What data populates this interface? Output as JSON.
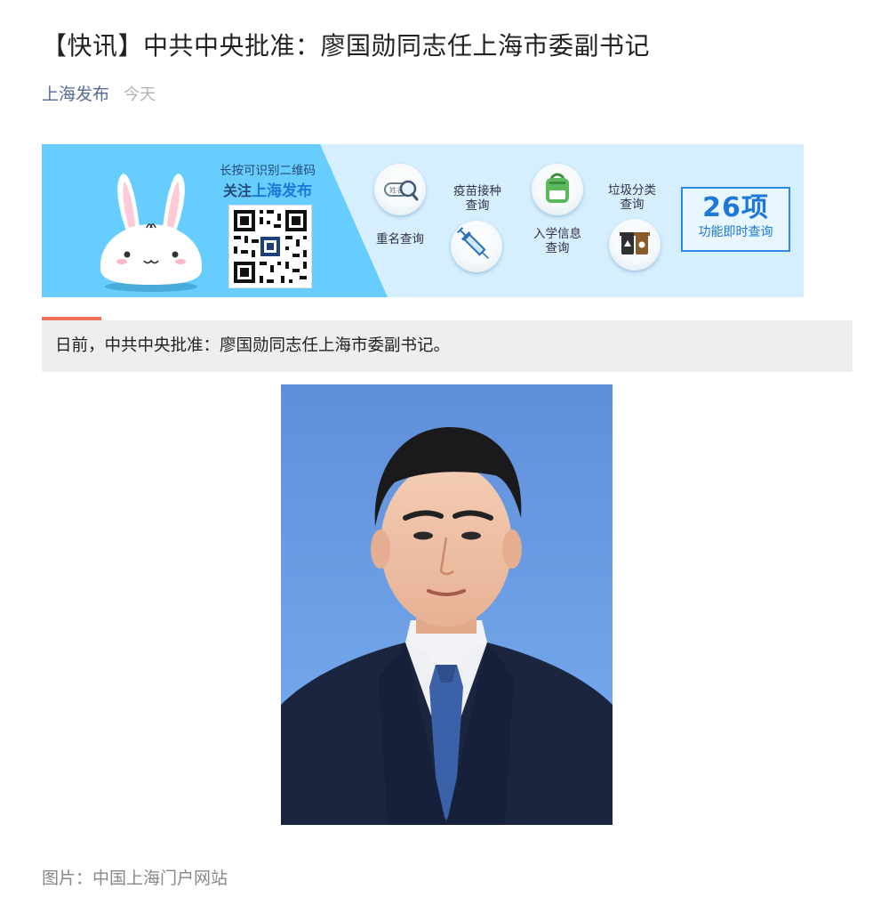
{
  "article": {
    "title": "【快讯】中共中央批准：廖国勋同志任上海市委副书记",
    "author": "上海发布",
    "date": "今天",
    "summary": "日前，中共中央批准：廖国勋同志任上海市委副书记。",
    "photo_caption": "图片：中国上海门户网站"
  },
  "banner": {
    "line1": "长按可识别二维码",
    "follow_prefix": "关注",
    "follow_name": "上海发布",
    "items": [
      {
        "label": "重名查询",
        "icon": "search-name-icon"
      },
      {
        "label": "疫苗接种\n查询",
        "icon": "syringe-icon"
      },
      {
        "label": "入学信息\n查询",
        "icon": "backpack-icon"
      },
      {
        "label": "垃圾分类\n查询",
        "icon": "trash-bins-icon"
      }
    ],
    "search_badge": "姓名",
    "count": "26项",
    "count_sub": "功能即时查询"
  },
  "colors": {
    "author_link": "#576b95",
    "accent_bar": "#f26f5b",
    "banner_blue": "#66cdfe",
    "banner_light": "#d6efff",
    "banner_accent": "#1e78d8"
  }
}
